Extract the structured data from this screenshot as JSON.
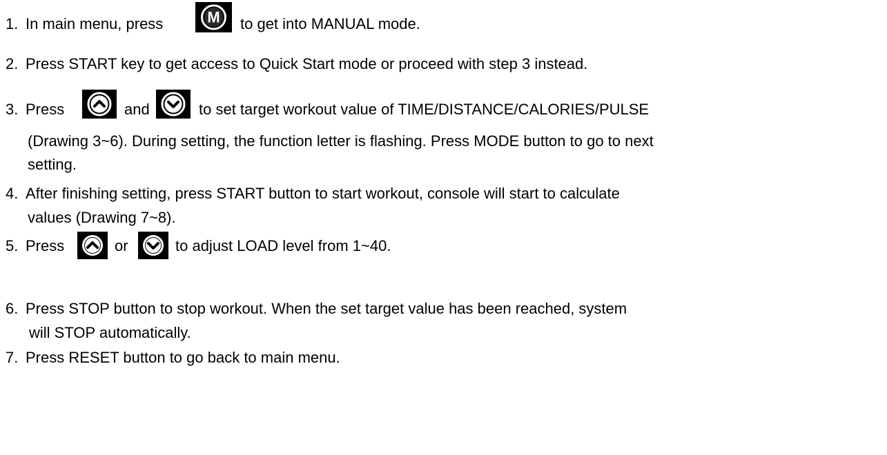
{
  "steps": [
    {
      "number": "1.",
      "before_icon": "In main menu, press",
      "icon": "m-button-icon",
      "after_icon": "to get into MANUAL mode."
    },
    {
      "number": "2.",
      "text": "Press START key to get access to Quick Start mode or proceed with step 3 instead."
    },
    {
      "number": "3.",
      "before_icon": "Press",
      "icon_up": "up-button-icon",
      "middle": "and",
      "icon_down": "down-button-icon",
      "after_icon": "to set target workout value of TIME/DISTANCE/CALORIES/PULSE",
      "continuation": [
        "(Drawing 3~6). During setting, the function letter is flashing. Press MODE button to go to next",
        "setting."
      ]
    },
    {
      "number": "4.",
      "text": "After finishing setting, press START button to start workout, console will start to calculate",
      "continuation": [
        "values (Drawing 7~8)."
      ]
    },
    {
      "number": "5.",
      "before_icon": "Press",
      "icon_up": "up-button-icon",
      "middle": "or",
      "icon_down": "down-button-icon",
      "after_icon": "to adjust LOAD level from 1~40."
    },
    {
      "number": "6.",
      "text": "Press STOP button to stop workout. When the set target value has been reached, system",
      "continuation": [
        "will STOP automatically."
      ]
    },
    {
      "number": "7.",
      "text": "Press RESET button to go back to main menu."
    }
  ],
  "icon_glyphs": {
    "m_button_letter": "M"
  },
  "colors": {
    "text": "#000000",
    "icon_background": "#000000",
    "icon_ring": "#ffffff",
    "icon_ring_dark": "#9a9a9a"
  }
}
